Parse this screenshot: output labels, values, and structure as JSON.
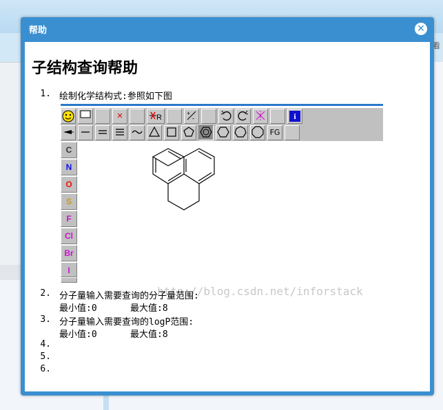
{
  "dialog": {
    "title": "帮助",
    "close_icon": "close-icon"
  },
  "page": {
    "heading": "子结构查询帮助",
    "background_text": "看"
  },
  "items": [
    {
      "number": "1.",
      "text": "绘制化学结构式:参照如下图"
    },
    {
      "number": "2.",
      "text": "分子量输入需要查询的分子量范围:",
      "min_label": "最小值:0",
      "max_label": "最大值:8"
    },
    {
      "number": "3.",
      "text": "分子量输入需要查询的logP范围:",
      "min_label": "最小值:0",
      "max_label": "最大值:8"
    },
    {
      "number": "4.",
      "text": ""
    },
    {
      "number": "5.",
      "text": ""
    },
    {
      "number": "6.",
      "text": ""
    }
  ],
  "editor": {
    "toolbar_labels": {
      "fg": "FG",
      "r": "R",
      "info": "i"
    },
    "atoms": [
      {
        "label": "C",
        "color": "#333333"
      },
      {
        "label": "N",
        "color": "#1010ee"
      },
      {
        "label": "O",
        "color": "#ee1010"
      },
      {
        "label": "S",
        "color": "#c89a20"
      },
      {
        "label": "F",
        "color": "#d010d0"
      },
      {
        "label": "Cl",
        "color": "#d010d0"
      },
      {
        "label": "Br",
        "color": "#d010d0"
      },
      {
        "label": "I",
        "color": "#d010d0"
      }
    ],
    "watermark": "http://blog.csdn.net/inforstack"
  },
  "colors": {
    "dialog_border": "#3a8fd0",
    "accent_line": "#2a78c8"
  }
}
